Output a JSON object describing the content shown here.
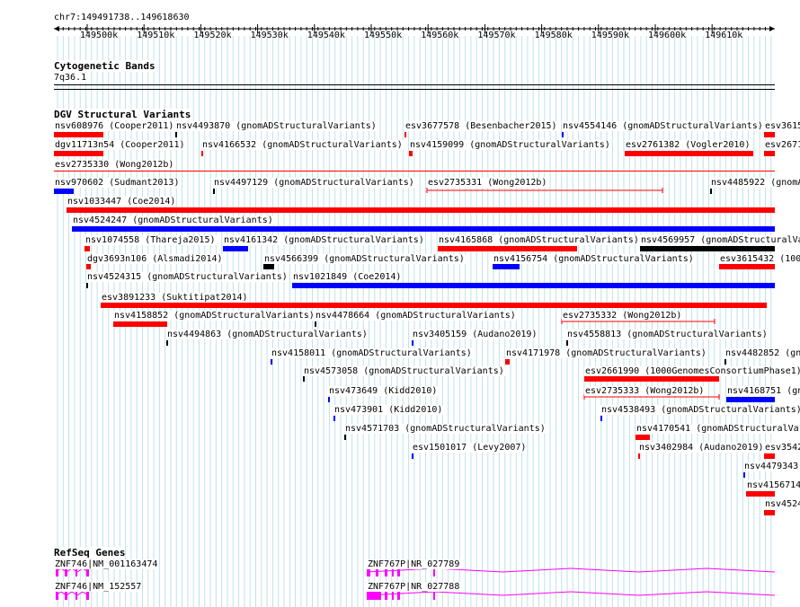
{
  "location": "chr7:149491738..149618630",
  "ruler": {
    "ticks": [
      "149500k",
      "149510k",
      "149520k",
      "149530k",
      "149540k",
      "149550k",
      "149560k",
      "149570k",
      "149580k",
      "149590k",
      "149600k",
      "149610k"
    ]
  },
  "cytobands": {
    "title": "Cytogenetic Bands",
    "band": "7q36.1"
  },
  "dgv": {
    "title": "DGV Structural Variants",
    "colors": {
      "red": "#ff0000",
      "blue": "#0000ff",
      "black": "#000000"
    },
    "features": [
      {
        "label": "nsv608976 (Cooper2011)",
        "color": "red"
      },
      {
        "label": "nsv4493870 (gnomADStructuralVariants)",
        "color": "black"
      },
      {
        "label": "esv3677578 (Besenbacher2015)",
        "color": "red"
      },
      {
        "label": "nsv4554146 (gnomADStructuralVariants)",
        "color": "blue"
      },
      {
        "label": "esv3615",
        "color": "red"
      },
      {
        "label": "dgv11713n54 (Cooper2011)",
        "color": "red"
      },
      {
        "label": "nsv4166532 (gnomADStructuralVariants)",
        "color": "red"
      },
      {
        "label": "nsv4159099 (gnomADStructuralVariants)",
        "color": "red"
      },
      {
        "label": "esv2761382 (Vogler2010)",
        "color": "red"
      },
      {
        "label": "esv2671",
        "color": "red"
      },
      {
        "label": "esv2735330 (Wong2012b)",
        "color": "red"
      },
      {
        "label": "nsv970602 (Sudmant2013)",
        "color": "blue"
      },
      {
        "label": "nsv4497129 (gnomADStructuralVariants)",
        "color": "black"
      },
      {
        "label": "esv2735331 (Wong2012b)",
        "color": "red"
      },
      {
        "label": "nsv4485922 (gnomA",
        "color": "black"
      },
      {
        "label": "nsv1033447 (Coe2014)",
        "color": "red"
      },
      {
        "label": "nsv4524247 (gnomADStructuralVariants)",
        "color": "blue"
      },
      {
        "label": "nsv1074558 (Thareja2015)",
        "color": "red"
      },
      {
        "label": "nsv4161342 (gnomADStructuralVariants)",
        "color": "blue"
      },
      {
        "label": "nsv4165868 (gnomADStructuralVariants)",
        "color": "red"
      },
      {
        "label": "nsv4569957 (gnomADStructuralVa",
        "color": "black"
      },
      {
        "label": "dgv3693n106 (Alsmadi2014)",
        "color": "red"
      },
      {
        "label": "nsv4566399 (gnomADStructuralVariants)",
        "color": "black"
      },
      {
        "label": "nsv4156754 (gnomADStructuralVariants)",
        "color": "blue"
      },
      {
        "label": "esv3615432 (1000",
        "color": "red"
      },
      {
        "label": "nsv4524315 (gnomADStructuralVariants)",
        "color": "black"
      },
      {
        "label": "nsv1021849 (Coe2014)",
        "color": "blue"
      },
      {
        "label": "esv3891233 (Suktitipat2014)",
        "color": "red"
      },
      {
        "label": "nsv4158852 (gnomADStructuralVariants)",
        "color": "red"
      },
      {
        "label": "nsv4478664 (gnomADStructuralVariants)",
        "color": "black"
      },
      {
        "label": "esv2735332 (Wong2012b)",
        "color": "red"
      },
      {
        "label": "nsv4494863 (gnomADStructuralVariants)",
        "color": "black"
      },
      {
        "label": "nsv3405159 (Audano2019)",
        "color": "blue"
      },
      {
        "label": "nsv4558813 (gnomADStructuralVariants)",
        "color": "black"
      },
      {
        "label": "nsv4158011 (gnomADStructuralVariants)",
        "color": "blue"
      },
      {
        "label": "nsv4171978 (gnomADStructuralVariants)",
        "color": "red"
      },
      {
        "label": "nsv4482852 (gnomA",
        "color": "black"
      },
      {
        "label": "nsv4573058 (gnomADStructuralVariants)",
        "color": "black"
      },
      {
        "label": "esv2661990 (1000GenomesConsortiumPhase1)",
        "color": "red"
      },
      {
        "label": "nsv473649 (Kidd2010)",
        "color": "blue"
      },
      {
        "label": "esv2735333 (Wong2012b)",
        "color": "red"
      },
      {
        "label": "nsv4168751 (gn",
        "color": "blue"
      },
      {
        "label": "nsv473901 (Kidd2010)",
        "color": "blue"
      },
      {
        "label": "nsv4538493 (gnomADStructuralVariants)",
        "color": "blue"
      },
      {
        "label": "nsv4571703 (gnomADStructuralVariants)",
        "color": "black"
      },
      {
        "label": "nsv4170541 (gnomADStructuralVar",
        "color": "red"
      },
      {
        "label": "esv1501017 (Levy2007)",
        "color": "blue"
      },
      {
        "label": "nsv3402984 (Audano2019)",
        "color": "red"
      },
      {
        "label": "esv3542",
        "color": "red"
      },
      {
        "label": "nsv4479343",
        "color": "blue"
      },
      {
        "label": "nsv4156714",
        "color": "red"
      },
      {
        "label": "nsv4524",
        "color": "red"
      }
    ]
  },
  "refseq": {
    "title": "RefSeq Genes",
    "color": "#ff00ff",
    "transcripts": [
      {
        "label": "ZNF746|NM_001163474"
      },
      {
        "label": "ZNF767P|NR_027789"
      },
      {
        "label": "ZNF746|NM_152557"
      },
      {
        "label": "ZNF767P|NR_027788"
      }
    ]
  }
}
